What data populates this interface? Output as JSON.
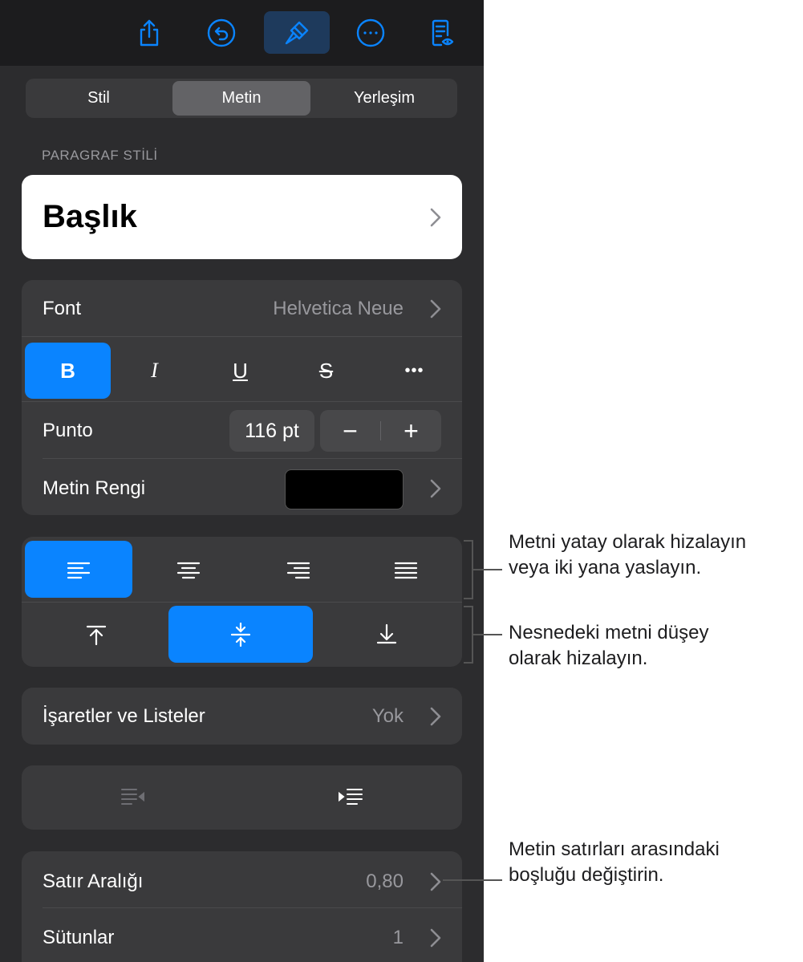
{
  "toolbar": {
    "icons": [
      "share-icon",
      "undo-icon",
      "paintbrush-icon",
      "more-icon",
      "reader-view-icon"
    ],
    "active": "paintbrush-icon"
  },
  "segments": [
    {
      "label": "Stil"
    },
    {
      "label": "Metin"
    },
    {
      "label": "Yerleşim"
    }
  ],
  "selected_segment": "Metin",
  "paragraph_style": {
    "section_label": "PARAGRAF STİLİ",
    "value": "Başlık"
  },
  "font": {
    "label": "Font",
    "value": "Helvetica Neue",
    "format_buttons": [
      {
        "label": "B",
        "active": true
      },
      {
        "label": "I",
        "active": false
      },
      {
        "label": "U",
        "active": false
      },
      {
        "label": "S",
        "active": false
      },
      {
        "label": "•••",
        "active": false
      }
    ],
    "size_label": "Punto",
    "size_value": "116 pt",
    "minus": "−",
    "plus": "+",
    "color_label": "Metin Rengi",
    "color_value": "#000000"
  },
  "alignment": {
    "horizontal": [
      "align-left-icon",
      "align-center-icon",
      "align-right-icon",
      "justify-icon"
    ],
    "horizontal_active": "align-left-icon",
    "vertical": [
      "align-top-icon",
      "align-middle-icon",
      "align-bottom-icon"
    ],
    "vertical_active": "align-middle-icon"
  },
  "bullets": {
    "label": "İşaretler ve Listeler",
    "value": "Yok"
  },
  "indent": {
    "decrease": "outdent-icon",
    "increase": "indent-icon"
  },
  "spacing": {
    "line_spacing_label": "Satır Aralığı",
    "line_spacing_value": "0,80",
    "columns_label": "Sütunlar",
    "columns_value": "1"
  },
  "callouts": {
    "horizontal": [
      "Metni yatay olarak hizalayın",
      "veya iki yana yaslayın."
    ],
    "vertical": [
      "Nesnedeki metni düşey",
      "olarak hizalayın."
    ],
    "spacing": [
      "Metin satırları arasındaki",
      "boşluğu değiştirin."
    ]
  },
  "colors": {
    "accent": "#0a84ff",
    "panel": "#2c2c2e",
    "group": "#3a3a3c"
  }
}
